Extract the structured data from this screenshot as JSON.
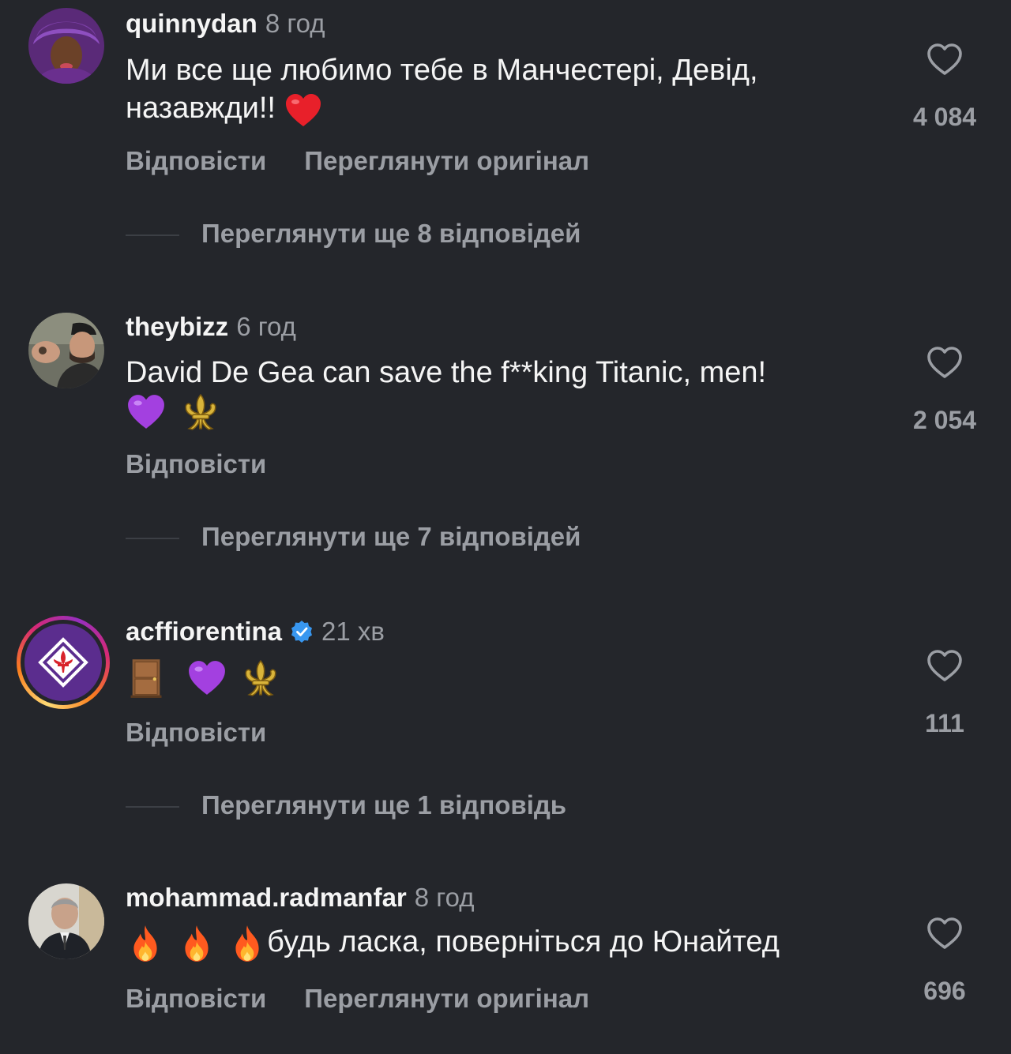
{
  "comments": [
    {
      "username": "quinnydan",
      "time": "8 год",
      "text": "Ми все ще любимо тебе в Манчестері, Девід, назавжди!!",
      "likes": "4 084",
      "reply_label": "Відповісти",
      "translate_label": "Переглянути оригінал",
      "more_replies": "Переглянути ще 8 відповідей",
      "emoji": [
        "red-heart"
      ]
    },
    {
      "username": "theybizz",
      "time": "6 год",
      "text": "David De Gea can save the f**king Titanic, men!",
      "likes": "2 054",
      "reply_label": "Відповісти",
      "more_replies": "Переглянути ще 7 відповідей",
      "emoji": [
        "purple-heart",
        "fleur-de-lis"
      ]
    },
    {
      "username": "acffiorentina",
      "verified": true,
      "time": "21 хв",
      "text": "",
      "likes": "111",
      "reply_label": "Відповісти",
      "more_replies": "Переглянути ще 1 відповідь",
      "emoji": [
        "door",
        "purple-heart",
        "fleur-de-lis"
      ]
    },
    {
      "username": "mohammad.radmanfar",
      "time": "8 год",
      "text": "будь ласка, поверніться до Юнайтед",
      "likes": "696",
      "reply_label": "Відповісти",
      "translate_label": "Переглянути оригінал",
      "emoji": [
        "fire",
        "fire",
        "fire"
      ]
    }
  ],
  "colors": {
    "background": "#24262b",
    "primary_text": "#f5f5f5",
    "secondary_text": "#9b9ea4",
    "verified_blue": "#3897f0"
  }
}
